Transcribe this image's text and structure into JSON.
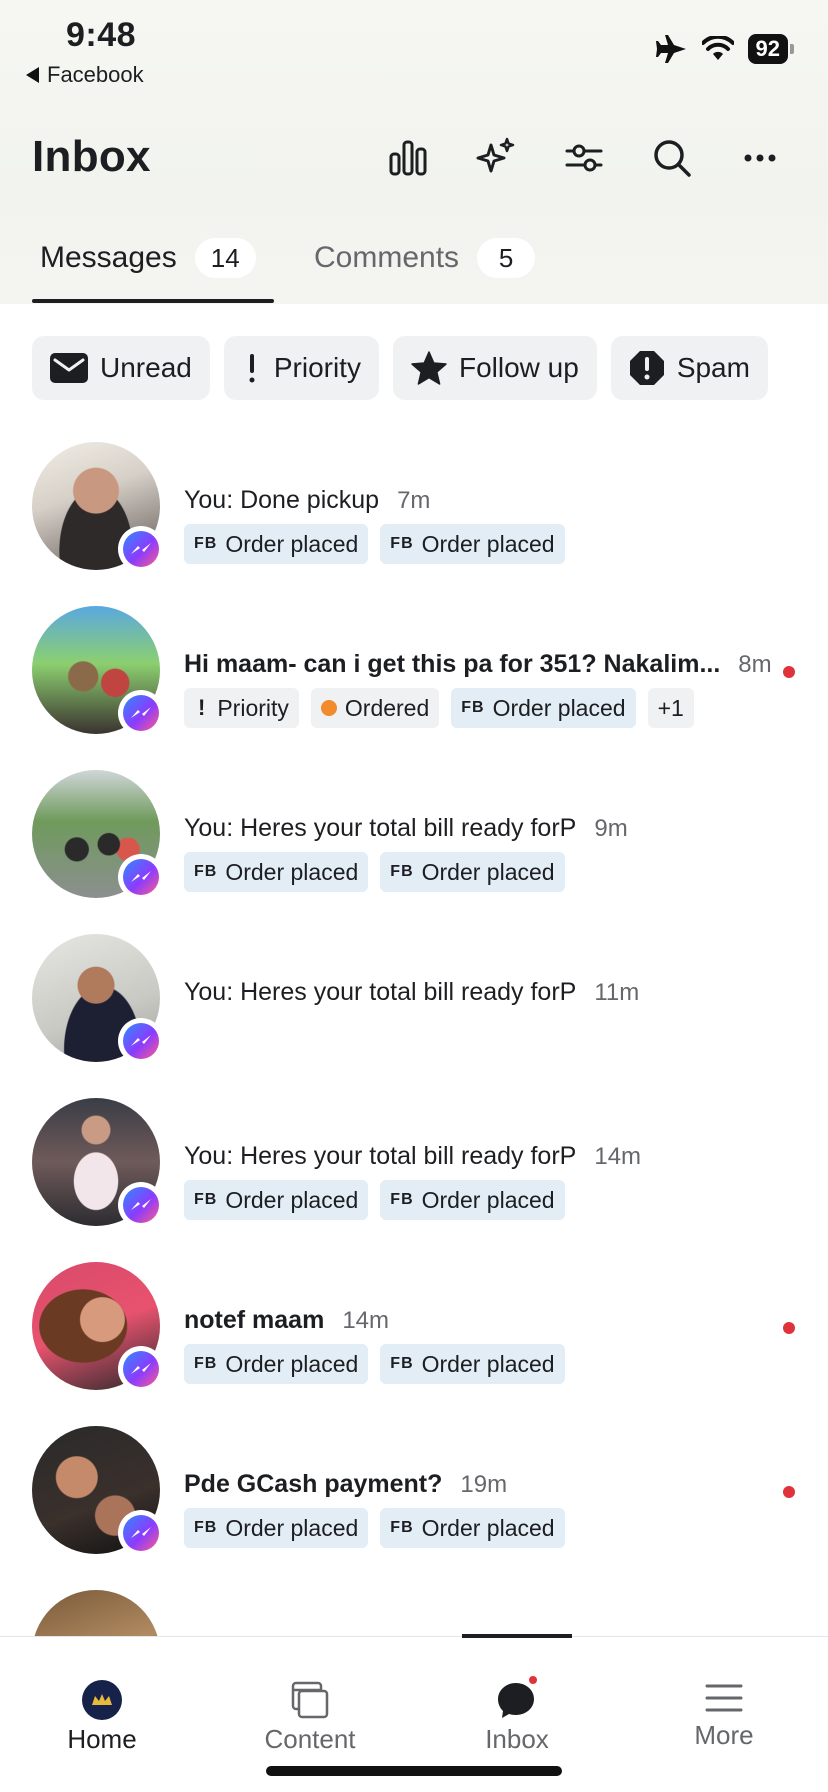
{
  "status_bar": {
    "time": "9:48",
    "back_app": "Facebook",
    "battery": "92"
  },
  "header": {
    "title": "Inbox",
    "icons": [
      "bar-chart-icon",
      "sparkle-icon",
      "filter-sliders-icon",
      "search-icon",
      "more-icon"
    ]
  },
  "tabs": [
    {
      "label": "Messages",
      "count": "14"
    },
    {
      "label": "Comments",
      "count": "5"
    }
  ],
  "filters": [
    {
      "label": "Unread",
      "icon": "envelope-icon"
    },
    {
      "label": "Priority",
      "icon": "exclamation-icon"
    },
    {
      "label": "Follow up",
      "icon": "star-icon"
    },
    {
      "label": "Spam",
      "icon": "spam-octagon-icon"
    }
  ],
  "conversations": [
    {
      "preview": "You: Done pickup",
      "time": "7m",
      "tags": [
        "Order placed",
        "Order placed"
      ]
    },
    {
      "preview": "Hi maam- can i get this pa for 351? Nakalim...",
      "time": "8m",
      "tags": [
        "Priority",
        "Ordered",
        "Order placed",
        "+1"
      ],
      "unread": true
    },
    {
      "preview": "You: Heres your total bill ready forP",
      "time": "9m",
      "tags": [
        "Order placed",
        "Order placed"
      ]
    },
    {
      "preview": "You: Heres your total bill ready forP",
      "time": "11m",
      "tags": []
    },
    {
      "preview": "You: Heres your total bill ready forP",
      "time": "14m",
      "tags": [
        "Order placed",
        "Order placed"
      ]
    },
    {
      "preview": "notef maam",
      "time": "14m",
      "tags": [
        "Order placed",
        "Order placed"
      ],
      "unread": true
    },
    {
      "preview": "Pde GCash payment?",
      "time": "19m",
      "tags": [
        "Order placed",
        "Order placed"
      ],
      "unread": true
    }
  ],
  "tag_prefix": "FB",
  "bottom_nav": [
    {
      "label": "Home"
    },
    {
      "label": "Content"
    },
    {
      "label": "Inbox"
    },
    {
      "label": "More"
    }
  ],
  "colors": {
    "unread_dot": "#e0323a",
    "tag_blue": "#e3edf6",
    "ordered_dot": "#f28b2c",
    "messenger_gradient": [
      "#2e8bff",
      "#8a3cff",
      "#ff5c8a"
    ]
  }
}
